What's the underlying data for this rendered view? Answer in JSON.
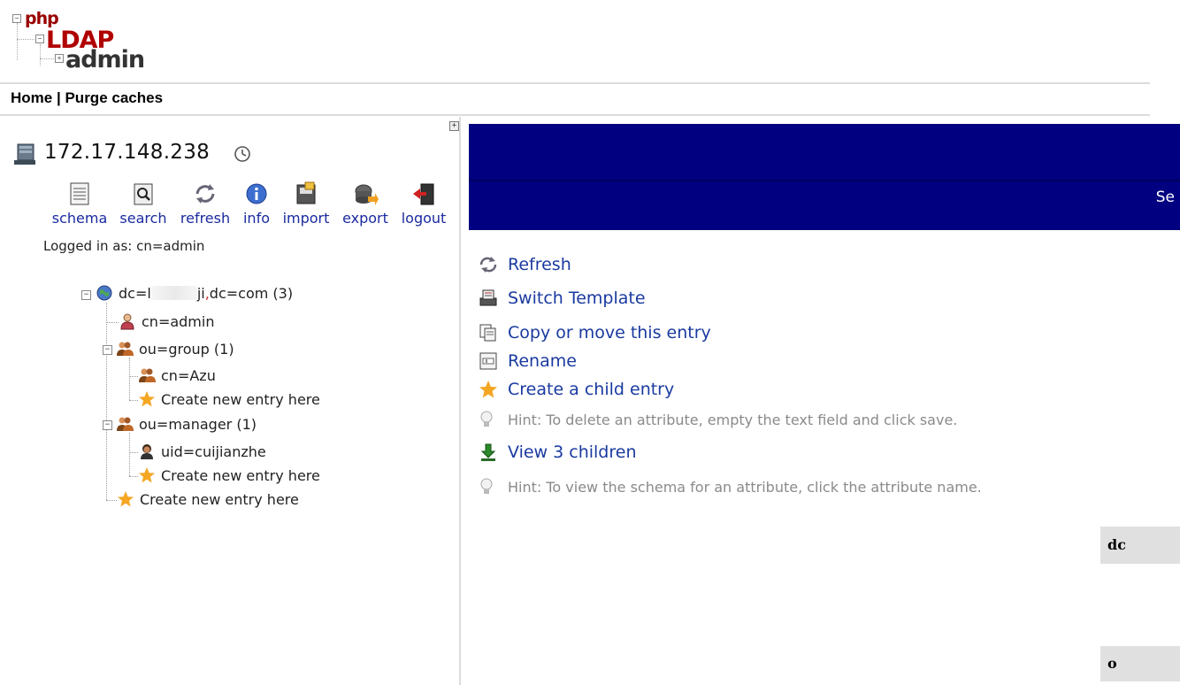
{
  "logo": {
    "php": "php",
    "ldap": "LDAP",
    "admin": "admin"
  },
  "menu": {
    "home": "Home",
    "separator": "|",
    "purge": "Purge caches"
  },
  "server": {
    "name": "172.17.148.238"
  },
  "tools": [
    {
      "label": "schema",
      "icon": "schema-icon"
    },
    {
      "label": "search",
      "icon": "search-icon"
    },
    {
      "label": "refresh",
      "icon": "refresh-icon"
    },
    {
      "label": "info",
      "icon": "info-icon"
    },
    {
      "label": "import",
      "icon": "import-icon"
    },
    {
      "label": "export",
      "icon": "export-icon"
    },
    {
      "label": "logout",
      "icon": "logout-icon"
    }
  ],
  "logged_in": "Logged in as: cn=admin",
  "tree": {
    "root": {
      "prefix": "dc=l",
      "suffix": "ji",
      "mark": ",",
      "rest": "dc=com (3)"
    },
    "admin": "cn=admin",
    "group": "ou=group (1)",
    "azu": "cn=Azu",
    "create_group": "Create new entry here",
    "manager": "ou=manager (1)",
    "uid": "uid=cuijianzhe",
    "create_manager": "Create new entry here",
    "create_root": "Create new entry here"
  },
  "banner": {
    "text": "Se"
  },
  "actions": {
    "refresh": "Refresh",
    "switch_template": "Switch Template",
    "copy_move": "Copy or move this entry",
    "rename": "Rename",
    "create_child": "Create a child entry",
    "hint_delete": "Hint: To delete an attribute, empty the text field and click save.",
    "view_children": "View 3 children",
    "hint_schema": "Hint: To view the schema for an attribute, click the attribute name."
  },
  "attributes": {
    "dc": "dc",
    "o": "o"
  },
  "colors": {
    "banner": "#000080",
    "link": "#1a3aa0",
    "hint": "#8a8a8a"
  }
}
